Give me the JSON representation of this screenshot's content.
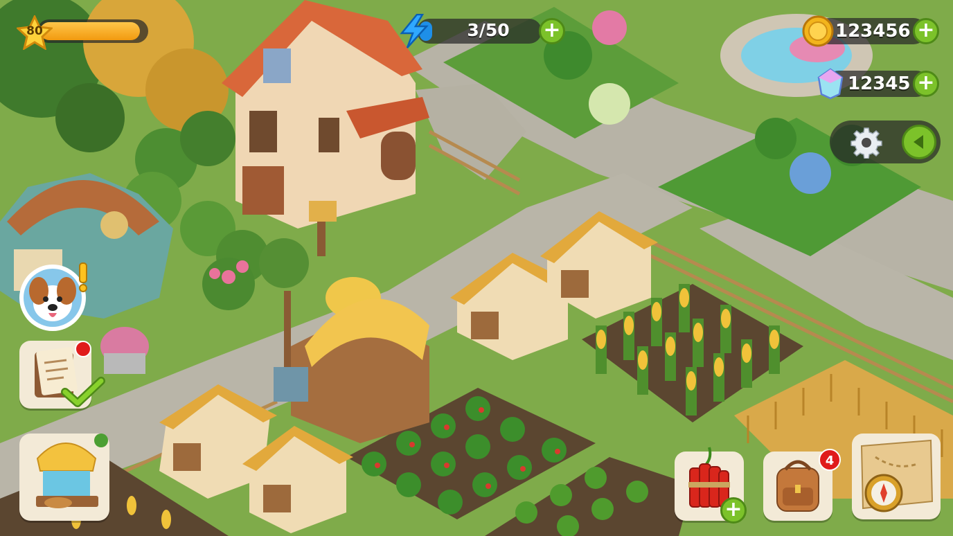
{
  "hud": {
    "level": "80",
    "xp_fraction": 0.95,
    "energy": "3/50",
    "coins": "123456",
    "gems": "12345",
    "plus_symbol": "+"
  },
  "icons": {
    "level": "star-icon",
    "energy": "lightning-icon",
    "coins": "gold-coin-icon",
    "gems": "crystal-gem-icon",
    "settings": "gear-icon",
    "collapse": "arrow-left-icon",
    "character": "dog-character-icon",
    "alert": "exclamation-icon",
    "tasks": "notepad-icon",
    "complete": "checkmark-icon",
    "shop": "market-stall-icon",
    "dynamite": "dynamite-icon",
    "inventory": "backpack-icon",
    "map": "treasure-map-icon"
  },
  "badges": {
    "inventory_count": "4"
  },
  "colors": {
    "plus_green": "#7cc22a",
    "xp_orange": "#f7a414",
    "energy_blue": "#1e8fe8",
    "badge_red": "#e01b1b"
  }
}
